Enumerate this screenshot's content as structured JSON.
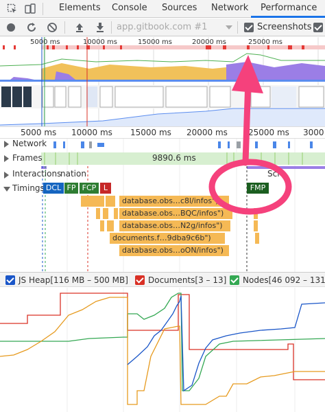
{
  "tabs": {
    "elements": "Elements",
    "console": "Console",
    "sources": "Sources",
    "network": "Network",
    "performance": "Performance"
  },
  "toolbar": {
    "url": "app.gitbook.com #1",
    "screenshots_label": "Screenshots"
  },
  "overview_ticks": [
    "5000 ms",
    "10000 ms",
    "15000 ms",
    "20000 ms",
    "25000 ms"
  ],
  "ruler_ticks": [
    "5000 ms",
    "10000 ms",
    "15000 ms",
    "20000 ms",
    "25000 ms",
    "3000"
  ],
  "tracks": {
    "network": "Network",
    "frames": "Frames",
    "frames_value": "9890.6 ms",
    "interactions": "Interactions",
    "interactions_suffix": "nation",
    "scroll_label": "Scro",
    "timings": "Timings"
  },
  "markers": {
    "dcl": "DCL",
    "fp": "FP",
    "fcp": "FCP",
    "l": "L",
    "fmp": "FMP"
  },
  "events": [
    "database.obs…c8l/infos\")",
    "database.obs…BQC/infos\")",
    "database.obs…N2g/infos\")",
    "documents.f…9dba9c6b\")",
    "database.obs…oON/infos\")"
  ],
  "legend": {
    "js_heap": "JS Heap[116 MB – 500 MB]",
    "documents": "Documents[3 – 13]",
    "nodes": "Nodes[46 092 – 131"
  },
  "colors": {
    "accent": "#1a73e8",
    "js_heap": "#1a56c8",
    "documents": "#d93025",
    "nodes": "#34a853",
    "listeners": "#e69a1e",
    "annotation": "#f5417c"
  }
}
